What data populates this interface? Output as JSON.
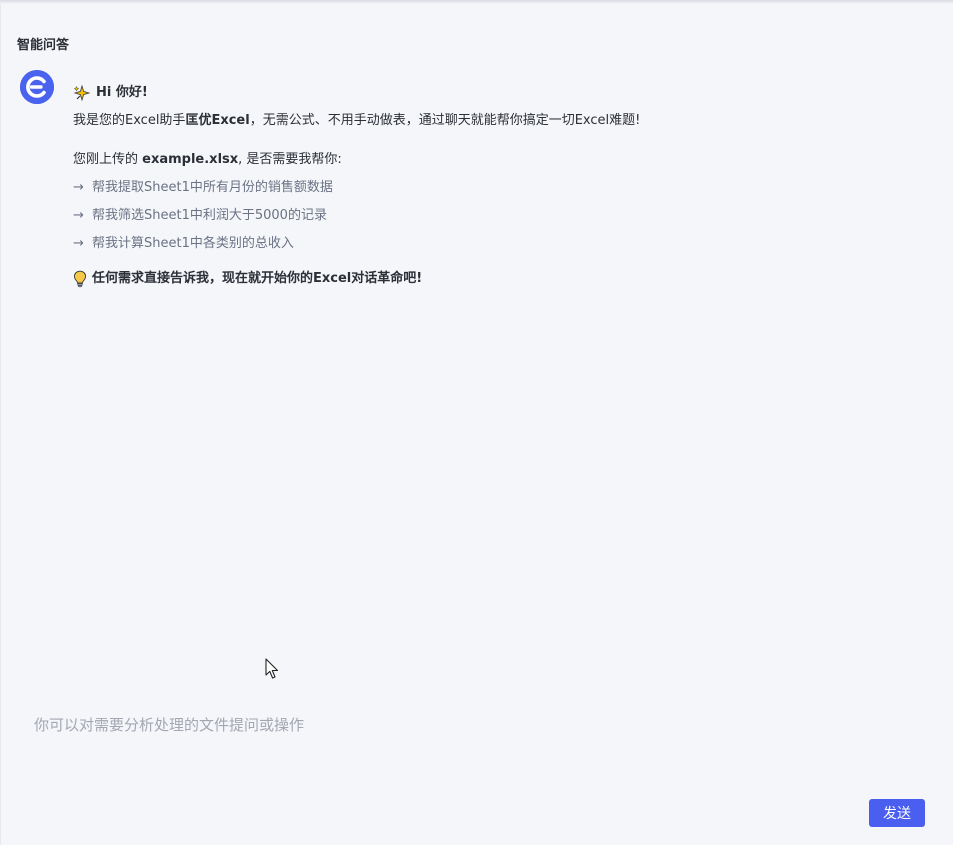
{
  "page": {
    "title": "智能问答"
  },
  "message": {
    "avatar_icon": "excel-assistant-logo-icon",
    "greeting": "Hi 你好!",
    "intro": {
      "prefix": "我是您的Excel助手",
      "brand": "匡优Excel",
      "suffix": "，无需公式、不用手动做表，通过聊天就能帮你搞定一切Excel难题!"
    },
    "upload": {
      "prefix": "您刚上传的 ",
      "filename": "example.xlsx",
      "suffix": ", 是否需要我帮你:"
    },
    "suggestions": [
      {
        "arrow": "→",
        "text": "帮我提取Sheet1中所有月份的销售额数据"
      },
      {
        "arrow": "→",
        "text": "帮我筛选Sheet1中利润大于5000的记录"
      },
      {
        "arrow": "→",
        "text": "帮我计算Sheet1中各类别的总收入"
      }
    ],
    "tip": "任何需求直接告诉我，现在就开始你的Excel对话革命吧!"
  },
  "composer": {
    "placeholder": "你可以对需要分析处理的文件提问或操作",
    "value": "",
    "send_label": "发送"
  },
  "colors": {
    "accent": "#4a5ef0",
    "suggestion_text": "#6a7284",
    "background": "#f5f6fa"
  }
}
